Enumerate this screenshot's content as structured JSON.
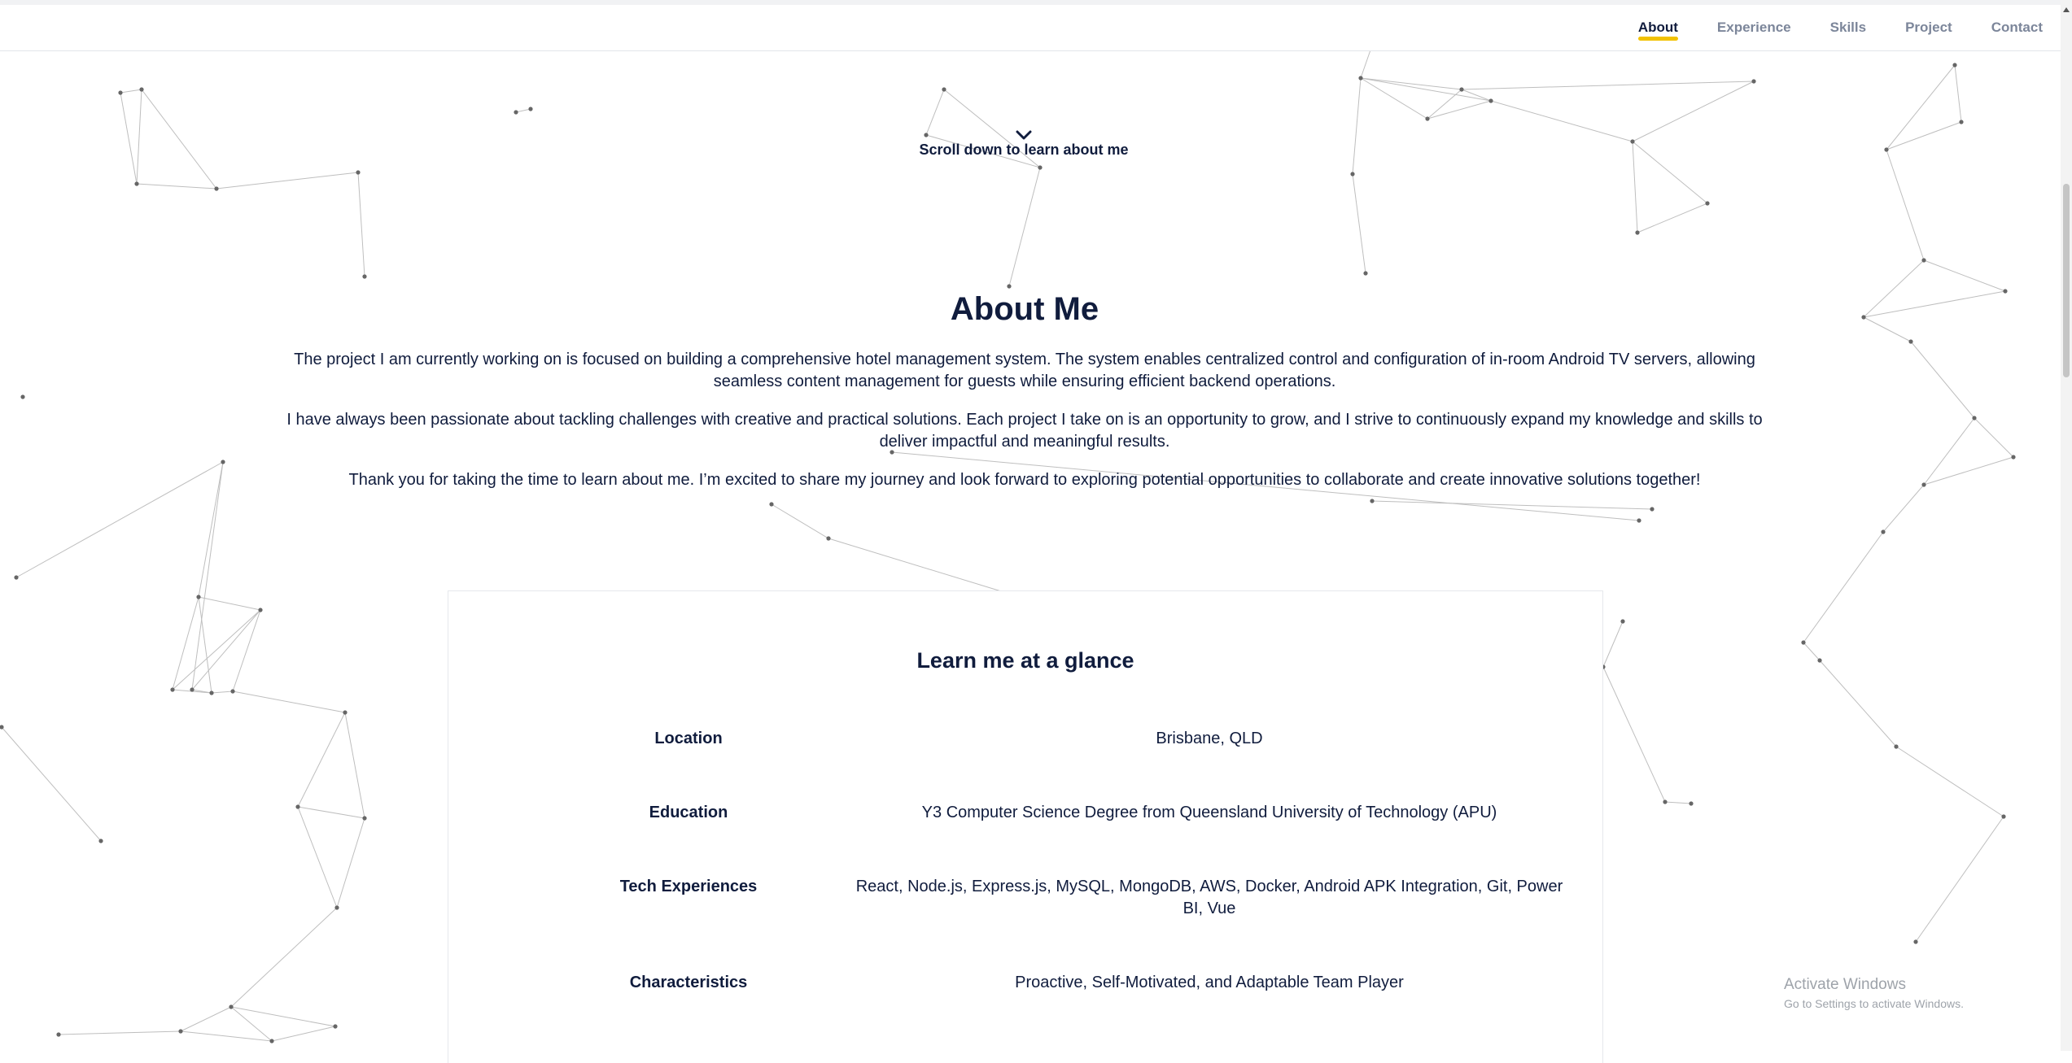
{
  "nav": {
    "items": [
      {
        "label": "About",
        "active": true
      },
      {
        "label": "Experience",
        "active": false
      },
      {
        "label": "Skills",
        "active": false
      },
      {
        "label": "Project",
        "active": false
      },
      {
        "label": "Contact",
        "active": false
      }
    ],
    "active_underline_color": "#f2c200"
  },
  "scroll_hint": {
    "icon": "chevron-down-icon",
    "text": "Scroll down to learn about me"
  },
  "about": {
    "title": "About Me",
    "paragraphs": [
      "The project I am currently working on is focused on building a comprehensive hotel management system. The system enables centralized control and configuration of in-room Android TV servers, allowing seamless content management for guests while ensuring efficient backend operations.",
      "I have always been passionate about tackling challenges with creative and practical solutions. Each project I take on is an opportunity to grow, and I strive to continuously expand my knowledge and skills to deliver impactful and meaningful results.",
      "Thank you for taking the time to learn about me. I’m excited to share my journey and look forward to exploring potential opportunities to collaborate and create innovative solutions together!"
    ]
  },
  "glance": {
    "title": "Learn me at a glance",
    "rows": [
      {
        "label": "Location",
        "value": "Brisbane, QLD"
      },
      {
        "label": "Education",
        "value": "Y3 Computer Science Degree from Queensland University of Technology (APU)"
      },
      {
        "label": "Tech Experiences",
        "value": "React, Node.js, Express.js, MySQL, MongoDB, AWS, Docker, Android APK Integration, Git, Power BI, Vue"
      },
      {
        "label": "Characteristics",
        "value": "Proactive, Self-Motivated, and Adaptable Team Player"
      }
    ]
  },
  "watermark": {
    "line1": "Activate Windows",
    "line2": "Go to Settings to activate Windows."
  },
  "colors": {
    "text": "#101c3d",
    "nav_inactive": "#7c869a",
    "accent": "#f2c200",
    "network_lines": "#9a9a9a"
  }
}
